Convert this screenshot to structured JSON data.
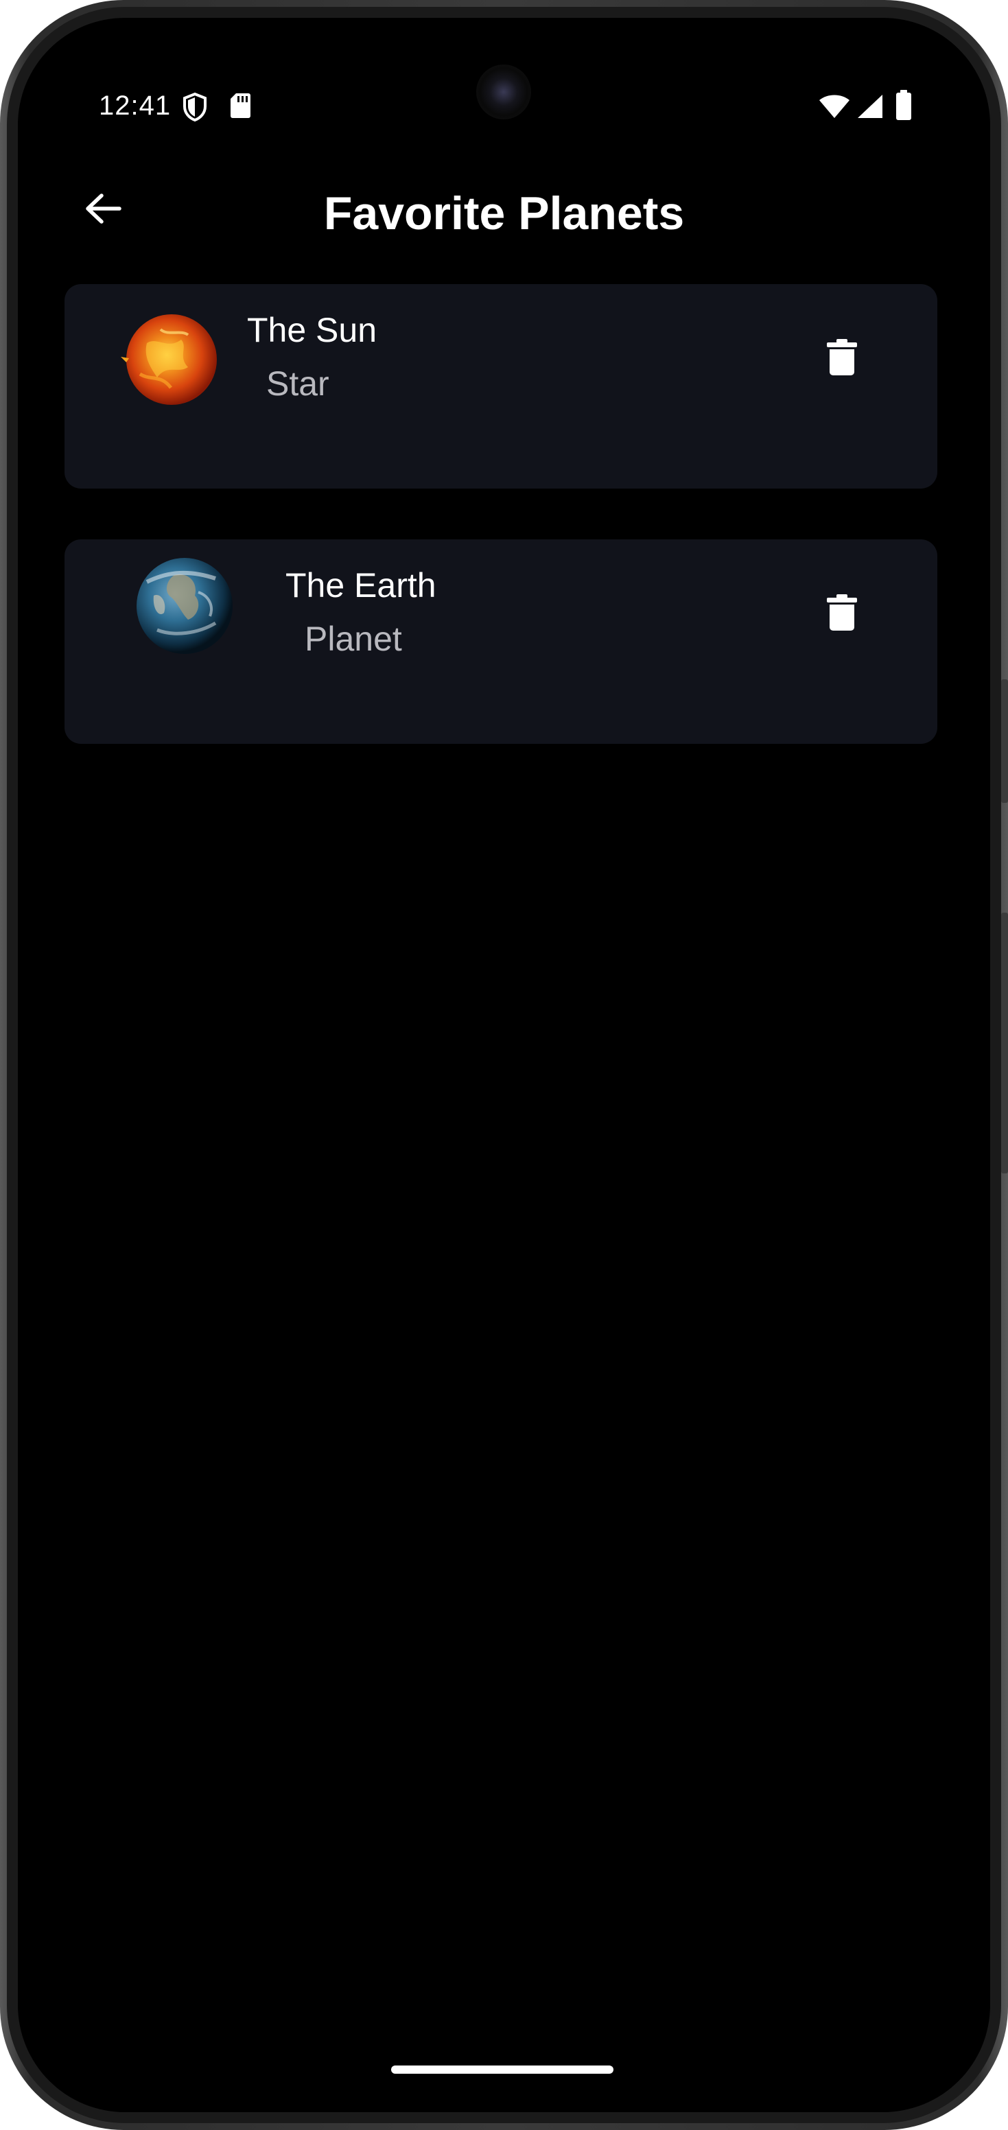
{
  "status_bar": {
    "time": "12:41",
    "left_icons": [
      "shield-icon",
      "sd-card-icon"
    ],
    "right_icons": [
      "wifi-icon",
      "signal-icon",
      "battery-icon"
    ]
  },
  "app_bar": {
    "title": "Favorite Planets",
    "back_icon": "arrow-left-icon"
  },
  "favorites": [
    {
      "name": "The Sun",
      "type": "Star",
      "image": "sun-image",
      "action_icon": "trash-icon"
    },
    {
      "name": "The Earth",
      "type": "Planet",
      "image": "earth-image",
      "action_icon": "trash-icon"
    }
  ],
  "colors": {
    "background": "#000000",
    "card": "#11131b",
    "title_text": "#ffffff",
    "subtitle_text": "#b9b9bf"
  }
}
